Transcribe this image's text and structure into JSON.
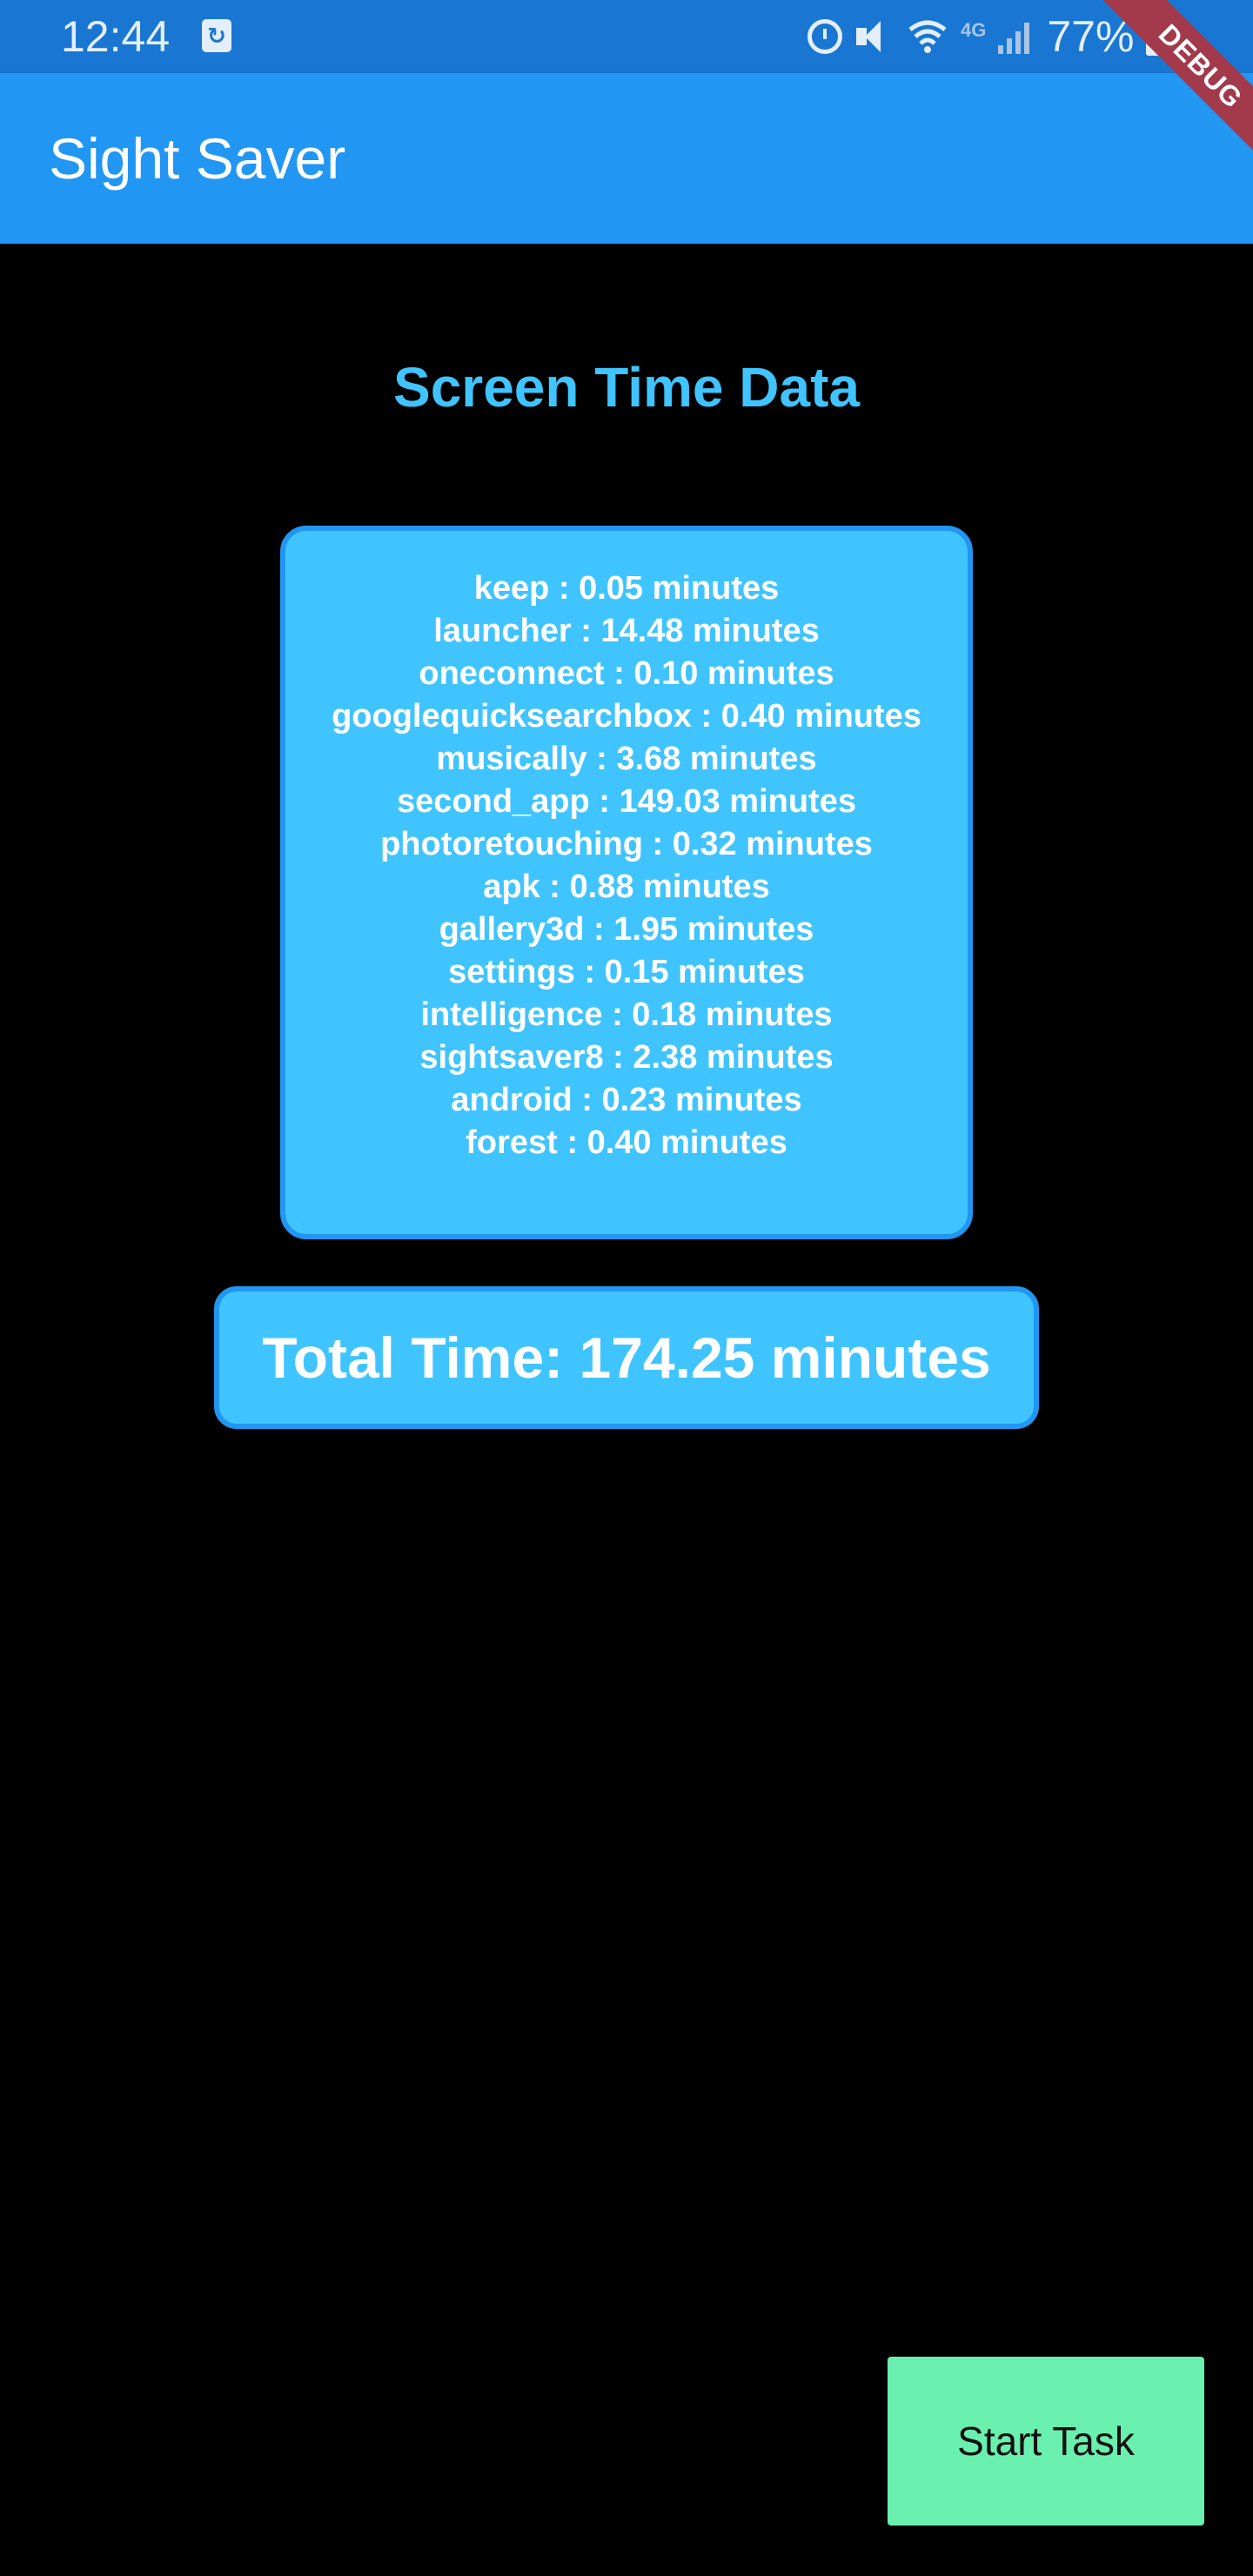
{
  "status_bar": {
    "time": "12:44",
    "sync_glyph": "↻",
    "network": "4G",
    "battery": "77%"
  },
  "app_bar": {
    "title": "Sight Saver"
  },
  "debug_banner": "DEBUG",
  "main": {
    "title": "Screen Time Data",
    "usage": [
      "keep : 0.05 minutes",
      "launcher : 14.48 minutes",
      "oneconnect : 0.10 minutes",
      "googlequicksearchbox : 0.40 minutes",
      "musically : 3.68 minutes",
      "second_app : 149.03 minutes",
      "photoretouching : 0.32 minutes",
      "apk : 0.88 minutes",
      "gallery3d : 1.95 minutes",
      "settings : 0.15 minutes",
      "intelligence : 0.18 minutes",
      "sightsaver8 : 2.38 minutes",
      "android : 0.23 minutes",
      "forest : 0.40 minutes"
    ],
    "total": "Total Time: 174.25 minutes"
  },
  "actions": {
    "start_task_label": "Start Task"
  },
  "colors": {
    "status_bar": "#1976D2",
    "app_bar": "#2196F3",
    "accent": "#40C4FF",
    "button": "#69F0AE",
    "background": "#000000"
  },
  "icons": [
    "sync-icon",
    "alarm-icon",
    "mute-icon",
    "wifi-icon",
    "signal-icon",
    "battery-icon"
  ]
}
